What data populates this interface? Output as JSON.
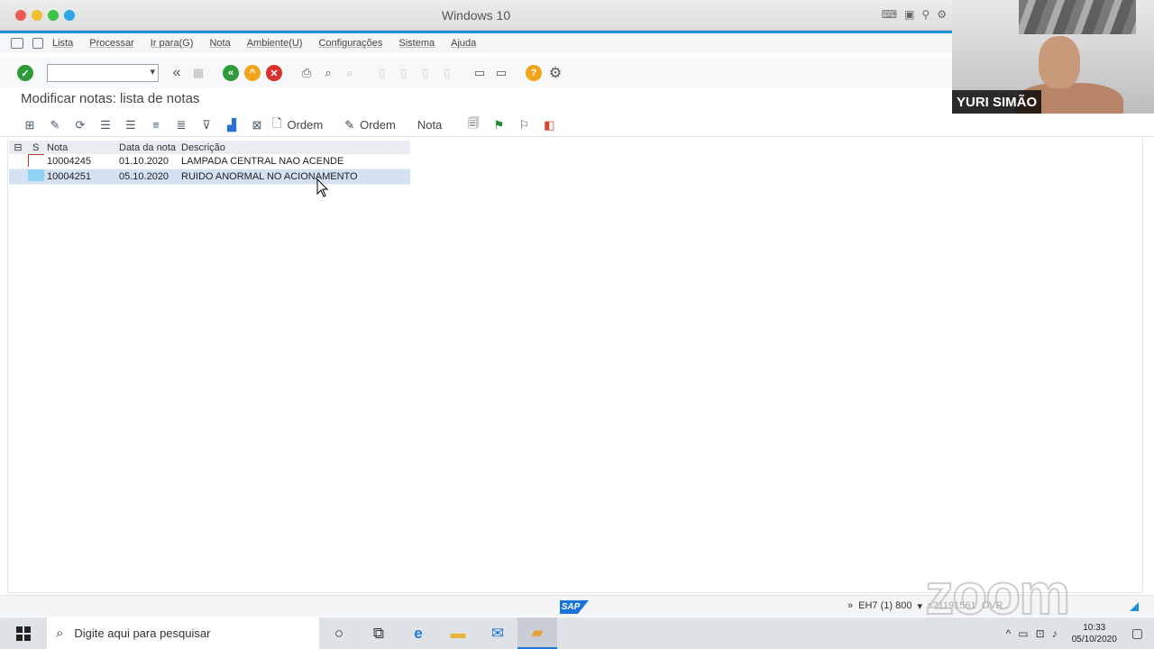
{
  "window": {
    "title": "Windows 10",
    "dot_colors": [
      "#ee5b52",
      "#f4bd2f",
      "#3cc343",
      "#2aa6e6"
    ]
  },
  "menu": {
    "items": [
      "Lista",
      "Processar",
      "Ir para(G)",
      "Nota",
      "Ambiente(U)",
      "Configurações",
      "Sistema",
      "Ajuda"
    ]
  },
  "toolbar": {
    "command_field_value": ""
  },
  "page": {
    "title": "Modificar notas: lista de notas"
  },
  "app_toolbar": {
    "ordem_label_1": "Ordem",
    "ordem_label_2": "Ordem",
    "nota_label": "Nota"
  },
  "grid": {
    "columns": {
      "s": "S",
      "nota": "Nota",
      "data": "Data da nota",
      "desc": "Descrição"
    },
    "rows": [
      {
        "nota": "10004245",
        "data": "01.10.2020",
        "desc": "LAMPADA CENTRAL NAO ACENDE",
        "selected": false
      },
      {
        "nota": "10004251",
        "data": "05.10.2020",
        "desc": "RUIDO ANORMAL NO ACIONAMENTO",
        "selected": true
      }
    ]
  },
  "statusbar": {
    "sap_logo": "SAP",
    "arrows": "»",
    "system": "EH7 (1) 800",
    "server": "s21191561",
    "mode": "OVR"
  },
  "taskbar": {
    "search_placeholder": "Digite aqui para pesquisar",
    "clock_time": "10:33",
    "clock_date": "05/10/2020"
  },
  "video": {
    "participant_name": "YURI SIMÃO",
    "watermark": "zoom"
  }
}
